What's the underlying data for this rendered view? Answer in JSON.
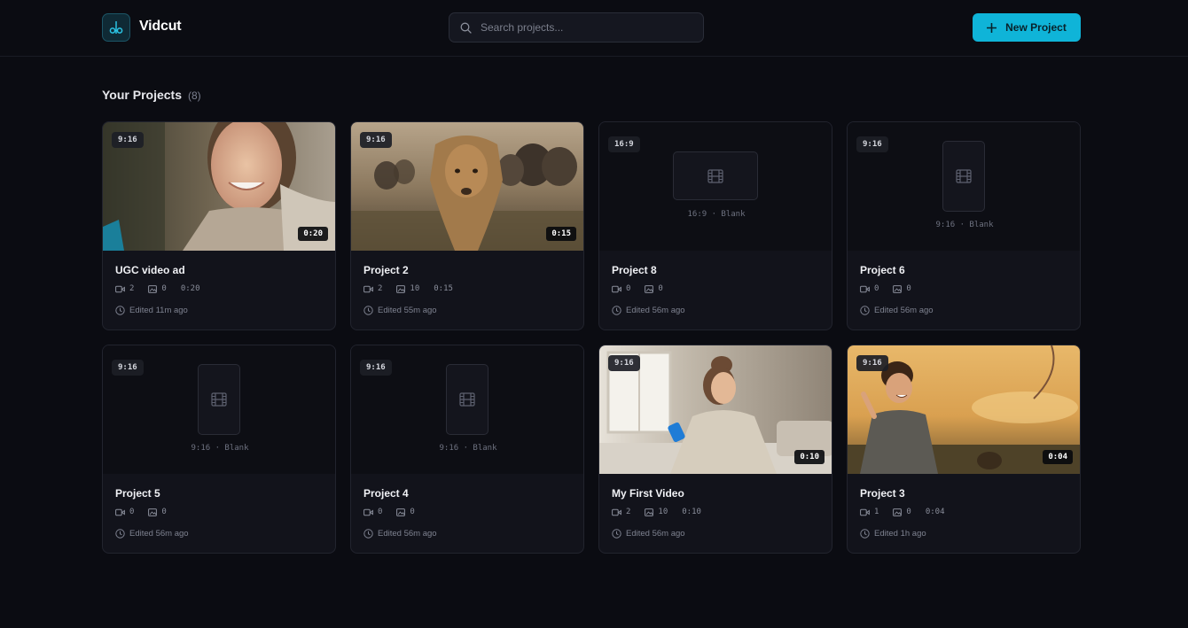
{
  "app": {
    "name": "Vidcut",
    "accent": "#0fb4d8"
  },
  "search": {
    "placeholder": "Search projects..."
  },
  "header": {
    "new_project_label": "New Project"
  },
  "section": {
    "title": "Your Projects",
    "count": "(8)"
  },
  "projects": [
    {
      "title": "UGC video ad",
      "ratio": "9:16",
      "duration": "0:20",
      "clips": "2",
      "images": "0",
      "length": "0:20",
      "edited": "Edited 11m ago",
      "thumbnail": "woman-smiling"
    },
    {
      "title": "Project 2",
      "ratio": "9:16",
      "duration": "0:15",
      "clips": "2",
      "images": "10",
      "length": "0:15",
      "edited": "Edited 55m ago",
      "thumbnail": "lioness-savanna"
    },
    {
      "title": "Project 8",
      "ratio": "16:9",
      "placeholder": "16:9 · Blank",
      "clips": "0",
      "images": "0",
      "edited": "Edited 56m ago",
      "thumbnail": "blank-wide"
    },
    {
      "title": "Project 6",
      "ratio": "9:16",
      "placeholder": "9:16 · Blank",
      "clips": "0",
      "images": "0",
      "edited": "Edited 56m ago",
      "thumbnail": "blank-tall"
    },
    {
      "title": "Project 5",
      "ratio": "9:16",
      "placeholder": "9:16 · Blank",
      "clips": "0",
      "images": "0",
      "edited": "Edited 56m ago",
      "thumbnail": "blank-tall"
    },
    {
      "title": "Project 4",
      "ratio": "9:16",
      "placeholder": "9:16 · Blank",
      "clips": "0",
      "images": "0",
      "edited": "Edited 56m ago",
      "thumbnail": "blank-tall"
    },
    {
      "title": "My First Video",
      "ratio": "9:16",
      "duration": "0:10",
      "clips": "2",
      "images": "10",
      "length": "0:10",
      "edited": "Edited 56m ago",
      "thumbnail": "woman-phone"
    },
    {
      "title": "Project 3",
      "ratio": "9:16",
      "duration": "0:04",
      "clips": "1",
      "images": "0",
      "length": "0:04",
      "edited": "Edited 1h ago",
      "thumbnail": "boy-sunset-kite"
    }
  ]
}
